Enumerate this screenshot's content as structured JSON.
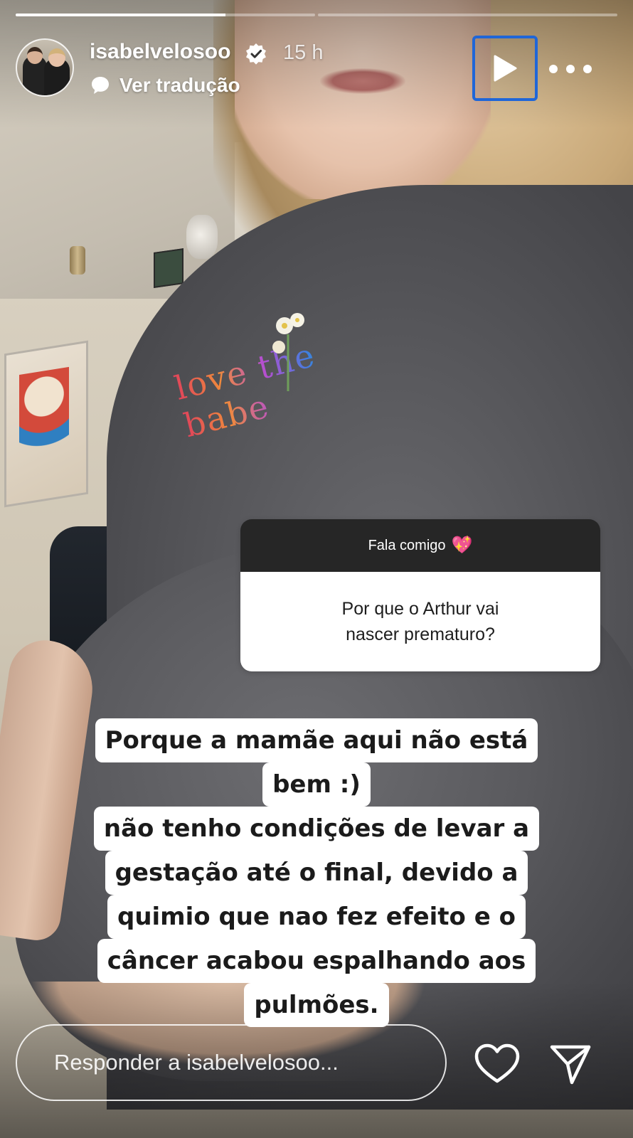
{
  "story": {
    "progress": {
      "segments_total": 2,
      "current_segment": 1,
      "current_fraction": 0.7
    },
    "header": {
      "username": "isabelvelosoo",
      "verified": true,
      "timestamp": "15 h",
      "translate_label": "Ver tradução",
      "avatar_icon": "avatar-couple-photo",
      "play_icon": "play-icon",
      "more_icon": "more-horizontal-icon"
    },
    "question_sticker": {
      "title": "Fala comigo",
      "title_emoji": "💖",
      "question": "Por que o Arthur vai nascer prematuro?"
    },
    "answer_lines": [
      "Porque a mamãe aqui não está",
      "bem :)",
      "não tenho condições de levar a",
      "gestação até o final, devido a",
      "quimio que nao fez efeito e o",
      "câncer acabou espalhando aos",
      "pulmões."
    ],
    "photo_embroidery_text": "love the babe",
    "reply": {
      "placeholder": "Responder a isabelvelosoo...",
      "like_icon": "heart-icon",
      "send_icon": "send-icon"
    },
    "colors": {
      "accent_focus": "#1f66d8",
      "sticker_header": "#262626",
      "sticker_body": "#ffffff",
      "text_dark": "#1b1b1b"
    }
  }
}
